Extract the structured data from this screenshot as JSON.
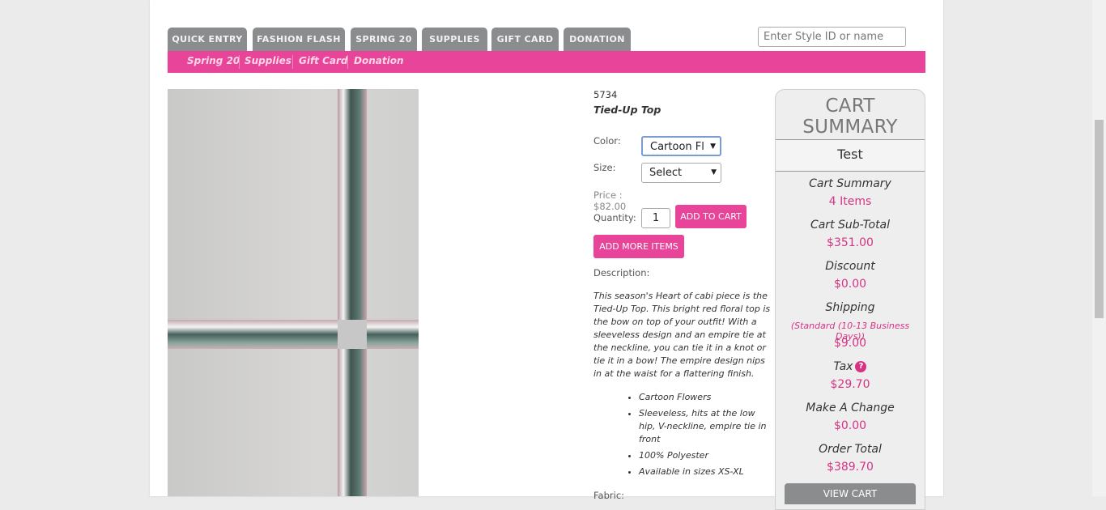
{
  "nav": {
    "tabs": [
      {
        "label": "QUICK ENTRY"
      },
      {
        "label": "FASHION FLASH"
      },
      {
        "label": "SPRING 20"
      },
      {
        "label": "SUPPLIES"
      },
      {
        "label": "GIFT CARD"
      },
      {
        "label": "DONATION"
      }
    ],
    "search_placeholder": "Enter Style ID or name",
    "subnav": [
      {
        "label": "Spring 20"
      },
      {
        "label": "Supplies"
      },
      {
        "label": "Gift Card"
      },
      {
        "label": "Donation"
      }
    ]
  },
  "product": {
    "style_id": "5734",
    "name": "Tied-Up Top",
    "color_label": "Color:",
    "color_value": "Cartoon Flowers",
    "size_label": "Size:",
    "size_value": "Select",
    "price": "Price : $82.00",
    "quantity_label": "Quantity:",
    "quantity_value": "1",
    "add_to_cart": "ADD TO CART",
    "add_more": "ADD MORE ITEMS",
    "description_label": "Description:",
    "description": "This season's Heart of cabi piece is the Tied-Up Top. This bright red floral top is the bow on top of your outfit! With a sleeveless design and an empire tie at the neckline, you can tie it in a knot or tie it in a bow! The empire design nips in at the waist for a flattering finish.",
    "bullets": [
      "Cartoon Flowers",
      "Sleeveless, hits at the low hip, V-neckline, empire tie in front",
      "100% Polyester",
      "Available in sizes XS-XL"
    ],
    "fabric_label": "Fabric:"
  },
  "cart": {
    "title": "CART SUMMARY",
    "user": "Test",
    "rows": [
      {
        "label": "Cart Summary",
        "value": "4 Items"
      },
      {
        "label": "Cart Sub-Total",
        "value": "$351.00"
      },
      {
        "label": "Discount",
        "value": "$0.00"
      },
      {
        "label": "Shipping",
        "note": "(Standard (10-13 Business Days))",
        "value": "$9.00"
      },
      {
        "label": "Tax",
        "value": "$29.70"
      },
      {
        "label": "Make A Change",
        "value": "$0.00"
      },
      {
        "label": "Order Total",
        "value": "$389.70"
      }
    ],
    "help_symbol": "?",
    "view_cart": "VIEW CART"
  }
}
